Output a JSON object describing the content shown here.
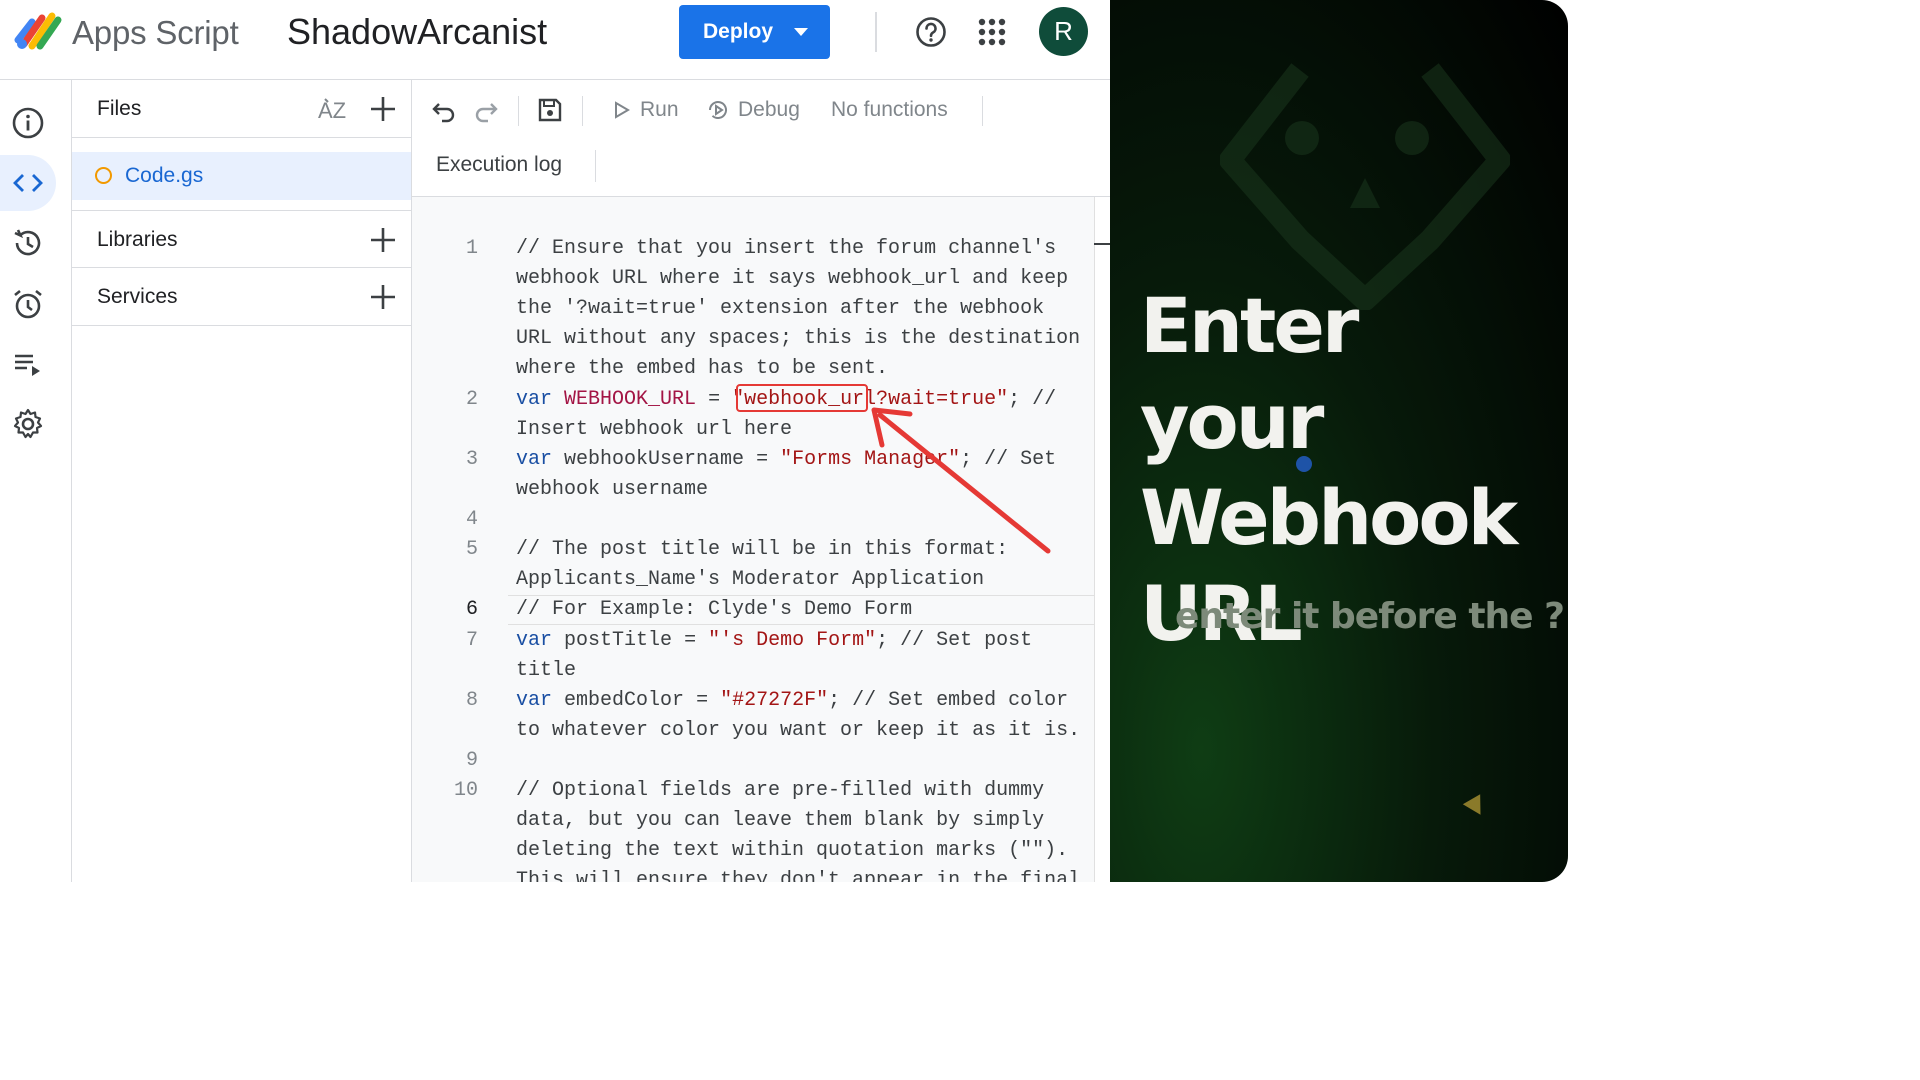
{
  "header": {
    "app_name": "Apps Script",
    "project_title": "ShadowArcanist",
    "deploy_label": "Deploy",
    "avatar_initial": "R",
    "avatar_color": "#0f4c3a"
  },
  "rail": {
    "items": [
      "info-icon",
      "code-icon",
      "history-icon",
      "alarm-icon",
      "executions-icon",
      "settings-icon"
    ],
    "active": "code-icon"
  },
  "files_panel": {
    "files_label": "Files",
    "sort_icon": "sort-az-icon",
    "file_name": "Code.gs",
    "libraries_label": "Libraries",
    "services_label": "Services"
  },
  "toolbar": {
    "run_label": "Run",
    "debug_label": "Debug",
    "functions_label": "No functions",
    "execution_log_label": "Execution log"
  },
  "code": {
    "current_line": "6",
    "lines": [
      {
        "n": "1",
        "t1": "// Ensure that you insert the forum channel's",
        "t2": "webhook URL where it says webhook_url and keep",
        "t3": "the '?wait=true' extension after the webhook",
        "t4": "URL without any spaces; this is the destination",
        "t5": "where the embed has to be sent."
      },
      {
        "n": "2",
        "kw": "var",
        "name": "WEBHOOK_URL",
        "eq": " = ",
        "q1": "\"",
        "hl": "webhook_url",
        "rest": "?wait=true\"",
        "comment": "; //",
        "cont": "Insert webhook url here"
      },
      {
        "n": "3",
        "kw": "var",
        "name": "webhookUsername",
        "eq": " = ",
        "str": "\"Forms Manager\"",
        "comment": "; // Set",
        "cont": "webhook username"
      },
      {
        "n": "4"
      },
      {
        "n": "5",
        "t1": "// The post title will be in this format:",
        "t2": "Applicants_Name's Moderator Application"
      },
      {
        "n": "6",
        "t1": "// For Example: Clyde's Demo Form"
      },
      {
        "n": "7",
        "kw": "var",
        "name": "postTitle",
        "eq": " = ",
        "str": "\"'s Demo Form\"",
        "comment": "; // Set post",
        "cont": "title"
      },
      {
        "n": "8",
        "kw": "var",
        "name": "embedColor",
        "eq": " = ",
        "str": "\"#27272F\"",
        "comment": "; // Set embed color",
        "cont": "to whatever color you want or keep it as it is."
      },
      {
        "n": "9"
      },
      {
        "n": "10",
        "t1": "// Optional fields are pre-filled with dummy",
        "t2": "data, but you can leave them blank by simply",
        "t3": "deleting the text within quotation marks (\"\").",
        "t4": "This will ensure they don't appear in the final"
      }
    ]
  },
  "overlay": {
    "headline_1": "Enter your",
    "headline_2": "Webhook",
    "headline_3": "URL",
    "subtitle": "enter it before the ?"
  },
  "colors": {
    "accent": "#1a73e8",
    "highlight": "#e53935",
    "file_dot": "#f29900"
  }
}
